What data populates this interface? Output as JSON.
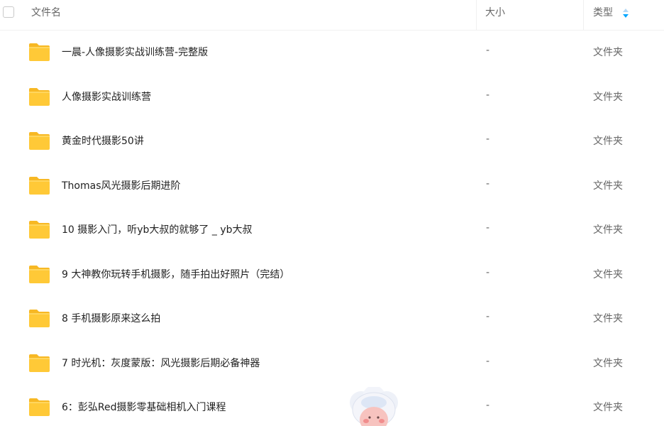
{
  "columns": {
    "name": "文件名",
    "size": "大小",
    "type": "类型"
  },
  "sort_icon": "sort-arrows-icon",
  "accent_color": "#06a7ff",
  "files": [
    {
      "name": "一晨-人像摄影实战训练营-完整版",
      "size": "-",
      "type": "文件夹"
    },
    {
      "name": "人像摄影实战训练营",
      "size": "-",
      "type": "文件夹"
    },
    {
      "name": "黄金时代摄影50讲",
      "size": "-",
      "type": "文件夹"
    },
    {
      "name": "Thomas风光摄影后期进阶",
      "size": "-",
      "type": "文件夹"
    },
    {
      "name": "10 摄影入门，听yb大叔的就够了 _ yb大叔",
      "size": "-",
      "type": "文件夹"
    },
    {
      "name": "9 大神教你玩转手机摄影，随手拍出好照片（完结）",
      "size": "-",
      "type": "文件夹"
    },
    {
      "name": "8 手机摄影原来这么拍",
      "size": "-",
      "type": "文件夹"
    },
    {
      "name": "7 时光机：灰度蒙版：风光摄影后期必备神器",
      "size": "-",
      "type": "文件夹"
    },
    {
      "name": "6：彭弘Red摄影零基础相机入门课程",
      "size": "-",
      "type": "文件夹"
    }
  ]
}
